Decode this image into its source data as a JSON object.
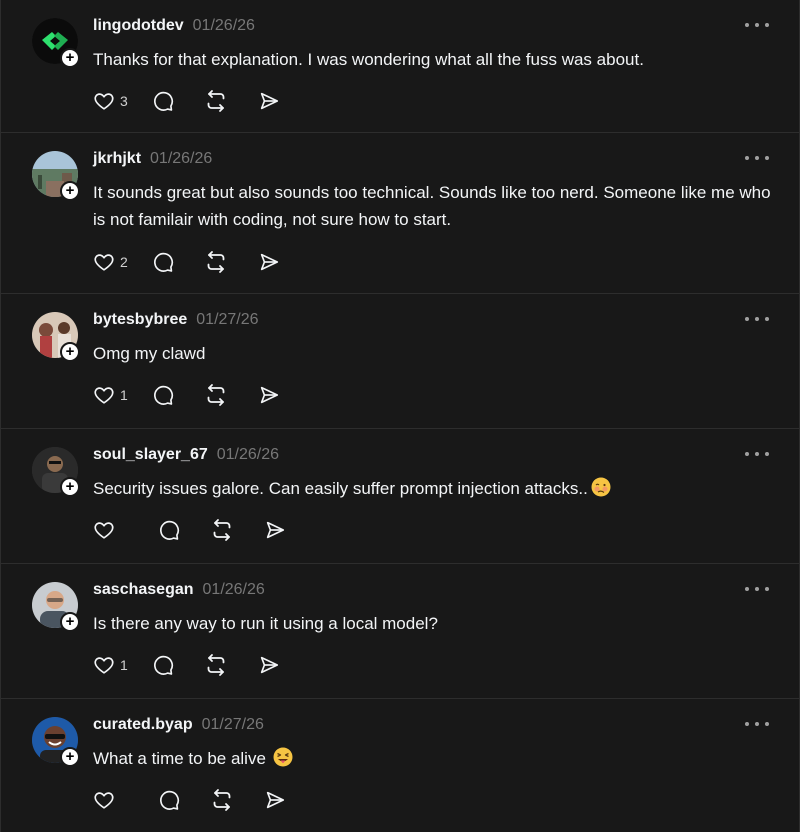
{
  "colors": {
    "background": "#181818",
    "divider": "#2d2d2d",
    "text_primary": "#f3f5f7",
    "text_secondary": "#777777",
    "badge": "#ffffff"
  },
  "icons": {
    "like": "heart-icon",
    "reply": "speech-bubble-icon",
    "repost": "repost-arrows-icon",
    "share": "paper-plane-icon",
    "more": "ellipsis-icon",
    "follow": "plus-icon"
  },
  "follow_glyph": "+",
  "posts": [
    {
      "username": "lingodotdev",
      "timestamp": "01/26/26",
      "text": "Thanks for that explanation. I was wondering what all the fuss was about.",
      "emoji": "",
      "likes": "3"
    },
    {
      "username": "jkrhjkt",
      "timestamp": "01/26/26",
      "text": "It sounds great but also sounds too technical. Sounds like too nerd. Someone like me who is not familair with coding, not sure how to start.",
      "emoji": "",
      "likes": "2"
    },
    {
      "username": "bytesbybree",
      "timestamp": "01/27/26",
      "text": "Omg my clawd",
      "emoji": "",
      "likes": "1"
    },
    {
      "username": "soul_slayer_67",
      "timestamp": "01/26/26",
      "text": "Security issues galore. Can easily suffer prompt injection attacks..",
      "emoji": "🥴",
      "likes": ""
    },
    {
      "username": "saschasegan",
      "timestamp": "01/26/26",
      "text": "Is there any way to run it using a local model?",
      "emoji": "",
      "likes": "1"
    },
    {
      "username": "curated.byap",
      "timestamp": "01/27/26",
      "text": "What a time to be alive",
      "emoji": "😝",
      "likes": ""
    }
  ]
}
